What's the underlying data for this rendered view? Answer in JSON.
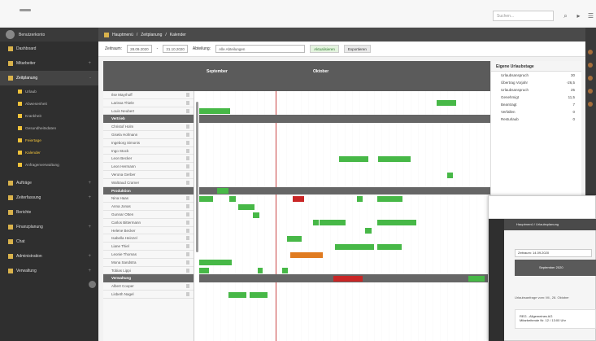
{
  "topbar": {
    "search_placeholder": "Suchen..."
  },
  "sidebar": {
    "user": "Benutzerkonto",
    "items": [
      {
        "label": "Dashboard"
      },
      {
        "label": "Mitarbeiter"
      },
      {
        "label": "Zeitplanung"
      },
      {
        "label": "Urlaub"
      },
      {
        "label": "Abwesenheit"
      },
      {
        "label": "Krankheit"
      },
      {
        "label": "Gesundheitsdaten"
      },
      {
        "label": "Feiertage"
      },
      {
        "label": "Kalender"
      },
      {
        "label": "Anfragenverwaltung"
      },
      {
        "label": "Aufträge"
      },
      {
        "label": "Zeiterfassung"
      },
      {
        "label": "Berichte"
      },
      {
        "label": "Finanzplanung"
      },
      {
        "label": "Chat"
      },
      {
        "label": "Administration"
      },
      {
        "label": "Verwaltung"
      }
    ]
  },
  "breadcrumb": {
    "home": "Hauptmenü",
    "section": "Zeitplanung",
    "page": "Kalender"
  },
  "filters": {
    "period_label": "Zeitraum:",
    "from": "28.09.2020",
    "to": "31.10.2020",
    "filter_label": "Abteilung:",
    "filter_value": "Alle Abteilungen",
    "button_active": "Aktualisieren",
    "button_other": "Exportieren"
  },
  "calendar": {
    "months": [
      "September",
      "Oktober"
    ]
  },
  "employees": [
    {
      "name": "Ilse Mayrhoff"
    },
    {
      "name": "Larissa Thiele"
    },
    {
      "name": "Louis Neubert"
    },
    {
      "section": "Vertrieb"
    },
    {
      "name": "Christof Holm"
    },
    {
      "name": "Gisela Hofmann"
    },
    {
      "name": "Ingeborg Simonis"
    },
    {
      "name": "Ingo Stock"
    },
    {
      "name": "Leon Becker"
    },
    {
      "name": "Leon Hermann"
    },
    {
      "name": "Verona Gerber"
    },
    {
      "name": "Waltraud Cramer"
    },
    {
      "section": "Produktion"
    },
    {
      "name": "Nina Haas"
    },
    {
      "name": "Anna Jonas"
    },
    {
      "name": "Gunnar Otten"
    },
    {
      "name": "Carlos Bittermann"
    },
    {
      "name": "Helene Becker"
    },
    {
      "name": "Isabella Heinzel"
    },
    {
      "name": "Liane Thiel"
    },
    {
      "name": "Leonie Thomas"
    },
    {
      "name": "Mona Sandstra"
    },
    {
      "name": "Tobias Lippi"
    },
    {
      "section": "Verwaltung"
    },
    {
      "name": "Albert Cooper"
    },
    {
      "name": "Lisbeth Nagel"
    }
  ],
  "right_panel": {
    "title": "Eigene Urlaubstage",
    "rows": [
      {
        "label": "Urlaubsanspruch",
        "value": "30"
      },
      {
        "label": "Übertrag Vorjahr",
        "value": "-26,5"
      },
      {
        "label": "Urlaubsanspruch",
        "value": "25"
      },
      {
        "label": "Genehmigt",
        "value": "11,5"
      },
      {
        "label": "Beantragt",
        "value": "7"
      },
      {
        "label": "Verfallen",
        "value": "0"
      },
      {
        "label": "Resturlaub",
        "value": "0"
      }
    ]
  },
  "inset": {
    "breadcrumb": "Hauptmenü / Urlaubsplanung",
    "date_label": "Zeitraum:",
    "date_value": "14.09.2020",
    "month": "September 2020",
    "info": "Urlaubsanfrage vom: Mi., 28. Oktober",
    "card_title": "REG - Allgemeines AG",
    "card_sub": "Mitarbeitende Nr. 12 / 13:00 Uhr"
  },
  "colors": {
    "accent": "#f0c23a",
    "approved": "#47b847",
    "requested": "#bfe0b3",
    "sick": "#c92626",
    "special": "#e07b20"
  }
}
